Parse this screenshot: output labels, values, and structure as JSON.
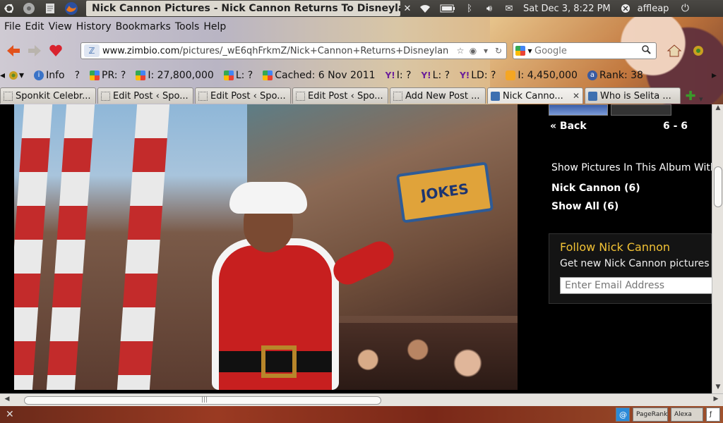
{
  "panel": {
    "window_title": "Nick Cannon Pictures - Nick Cannon Returns To Disneyla...",
    "clock": "Sat Dec  3,  8:22 PM",
    "username": "affleap"
  },
  "menu": [
    "File",
    "Edit",
    "View",
    "History",
    "Bookmarks",
    "Tools",
    "Help"
  ],
  "navbar": {
    "url_domain": "www.zimbio.com",
    "url_path": "/pictures/_wE6qhFrkmZ/Nick+Cannon+Returns+Disneylan",
    "search_placeholder": "Google"
  },
  "seo_toolbar": [
    {
      "label": "Info",
      "icon": "info-icon"
    },
    {
      "label": "?",
      "icon": "none"
    },
    {
      "label": "PR: ?",
      "icon": "google-icon"
    },
    {
      "label": "I: 27,800,000",
      "icon": "google-icon"
    },
    {
      "label": "L: ?",
      "icon": "google-icon"
    },
    {
      "label": "Cached: 6 Nov 2011",
      "icon": "google-icon"
    },
    {
      "label": "I: ?",
      "icon": "yahoo-icon"
    },
    {
      "label": "L: ?",
      "icon": "yahoo-icon"
    },
    {
      "label": "LD: ?",
      "icon": "yahoo-icon"
    },
    {
      "label": "I: 4,450,000",
      "icon": "bing-icon"
    },
    {
      "label": "Rank: 38",
      "icon": "alexa-icon"
    }
  ],
  "tabs": [
    {
      "label": "Sponkit Celebr...",
      "active": false,
      "zimbio": false
    },
    {
      "label": "Edit Post ‹ Spo...",
      "active": false,
      "zimbio": false
    },
    {
      "label": "Edit Post ‹ Spo...",
      "active": false,
      "zimbio": false
    },
    {
      "label": "Edit Post ‹ Spo...",
      "active": false,
      "zimbio": false
    },
    {
      "label": "Add New Post ...",
      "active": false,
      "zimbio": false
    },
    {
      "label": "Nick Canno...",
      "active": true,
      "zimbio": true
    },
    {
      "label": "Who is Selita ...",
      "active": false,
      "zimbio": true
    }
  ],
  "photo": {
    "sign_text": "JOKES"
  },
  "sidebar": {
    "back_label": "Back",
    "counter": "6 - 6",
    "show_heading": "Show Pictures In This Album With:",
    "album_link": "Nick Cannon (6)",
    "show_all": "Show All (6)",
    "follow_title": "Follow Nick Cannon",
    "follow_sub": "Get new Nick Cannon pictures by e",
    "email_placeholder": "Enter Email Address"
  },
  "statusbar": {
    "pagerank_label": "PageRank",
    "alexa_label": "Alexa"
  },
  "colors": {
    "follow_title": "#f2c235",
    "statusbar": "#9a3a22"
  }
}
